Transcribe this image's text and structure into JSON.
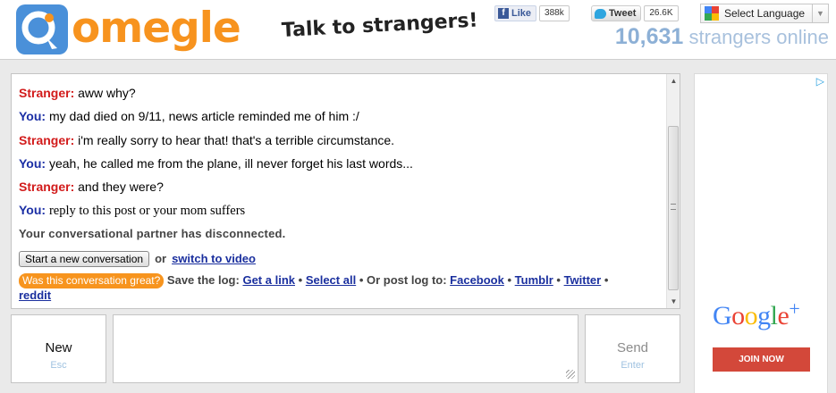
{
  "header": {
    "logo_text": "omegle",
    "tagline": "Talk to strangers!",
    "facebook": {
      "label": "Like",
      "count": "388k"
    },
    "twitter": {
      "label": "Tweet",
      "count": "26.6K"
    },
    "language": {
      "label": "Select Language"
    },
    "online": {
      "count": "10,631",
      "suffix": "strangers online"
    }
  },
  "chat": {
    "messages": [
      {
        "who": "Stranger:",
        "text": "aww why?"
      },
      {
        "who": "You:",
        "text": "my dad died on 9/11, news article reminded me of him :/"
      },
      {
        "who": "Stranger:",
        "text": "i'm really sorry to hear that! that's a terrible circumstance."
      },
      {
        "who": "You:",
        "text": "yeah, he called me from the plane, ill never forget his last words..."
      },
      {
        "who": "Stranger:",
        "text": "and they were?"
      },
      {
        "who": "You:",
        "text": "reply to this post or your mom suffers"
      }
    ],
    "status": "Your conversational partner has disconnected.",
    "new_conversation_label": "Start a new conversation",
    "or_text": "or",
    "switch_video_label": "switch to video",
    "great_label": "Was this conversation great?",
    "save_log_text": "Save the log:",
    "get_link_label": "Get a link",
    "select_all_label": "Select all",
    "post_log_text": "Or post log to:",
    "facebook_label": "Facebook",
    "tumblr_label": "Tumblr",
    "twitter_label": "Twitter",
    "reddit_label": "reddit",
    "separator": "•"
  },
  "controls": {
    "new_label": "New",
    "new_hint": "Esc",
    "message_value": "",
    "send_label": "Send",
    "send_hint": "Enter"
  },
  "ad": {
    "brand": "Google",
    "brand_plus": "+",
    "join_label": "JOIN NOW",
    "choices_icon": "adchoices-icon"
  },
  "colors": {
    "brand_orange": "#f7931e",
    "stranger_red": "#d21b1b",
    "you_blue": "#1b2fa5",
    "online_blue": "#8db0d6",
    "google_plus_red": "#d3483a"
  }
}
